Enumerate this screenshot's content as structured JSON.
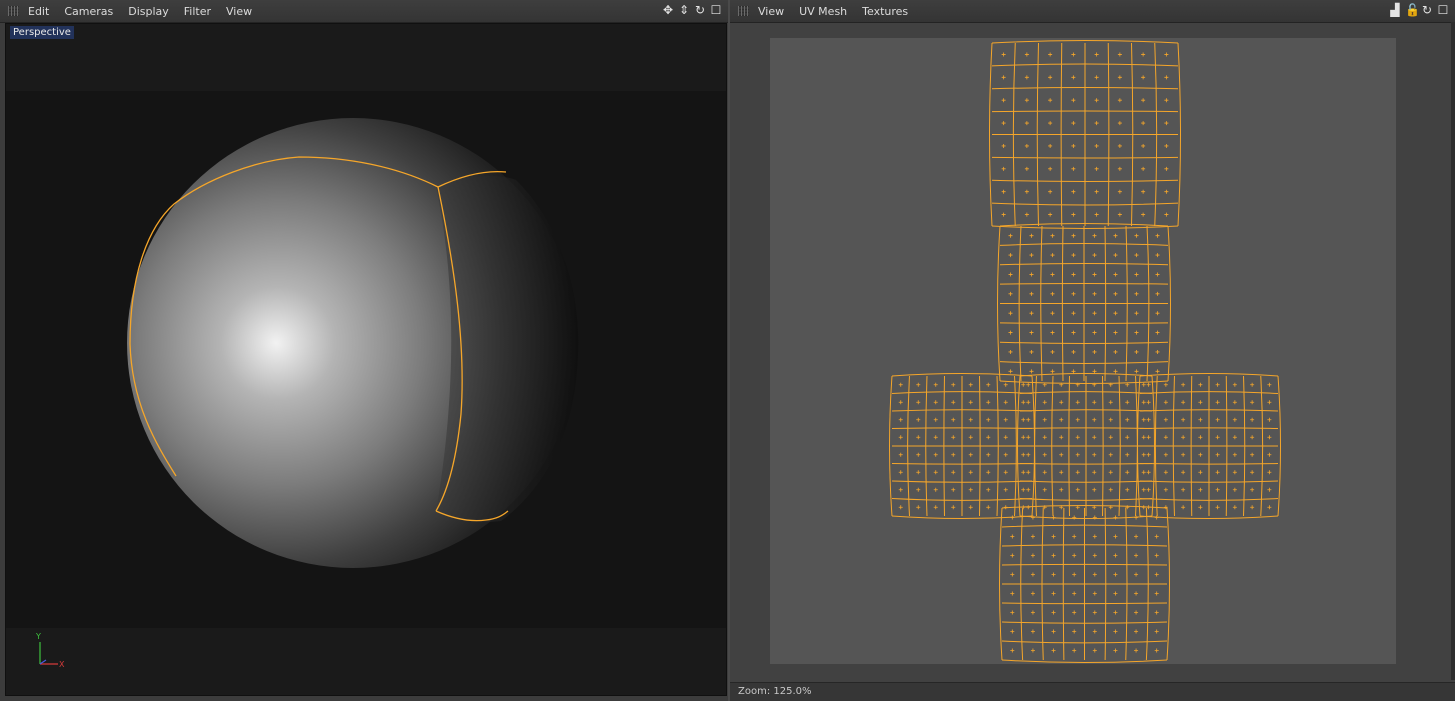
{
  "left_panel": {
    "menu": [
      "Edit",
      "Cameras",
      "Display",
      "Filter",
      "View"
    ],
    "view_label": "Perspective",
    "axes": {
      "y": "Y",
      "x": "X",
      "x_color": "#d33a3a",
      "y_color": "#3ec33e",
      "z_color": "#4a5adf"
    },
    "icons": [
      "move-view-icon",
      "dolly-view-icon",
      "rotate-view-icon",
      "maximize-view-icon"
    ]
  },
  "right_panel": {
    "menu": [
      "View",
      "UV Mesh",
      "Textures"
    ],
    "icons": [
      "histogram-icon",
      "lock-icon",
      "refresh-icon",
      "maximize-view-icon"
    ],
    "status": "Zoom: 125.0%"
  },
  "colors": {
    "selection": "#f5a62a",
    "uv_background": "#555555",
    "viewport_background": "#141414"
  }
}
